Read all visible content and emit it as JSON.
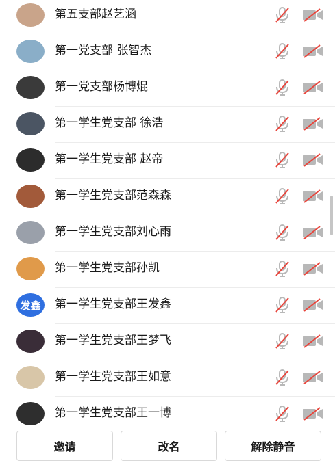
{
  "participants": [
    {
      "name": "第五支部赵艺涵",
      "avatar_color": "#c9a48a",
      "mic_muted": true,
      "camera_off": true
    },
    {
      "name": "第一党支部 张智杰",
      "avatar_color": "#8aaec8",
      "mic_muted": true,
      "camera_off": true
    },
    {
      "name": "第一党支部杨博焜",
      "avatar_color": "#3a3a3a",
      "mic_muted": true,
      "camera_off": true
    },
    {
      "name": "第一学生党支部 徐浩",
      "avatar_color": "#4b5563",
      "mic_muted": true,
      "camera_off": true
    },
    {
      "name": "第一学生党支部 赵帝",
      "avatar_color": "#2c2c2c",
      "mic_muted": true,
      "camera_off": true
    },
    {
      "name": "第一学生党支部范森森",
      "avatar_color": "#a25a3a",
      "mic_muted": true,
      "camera_off": true
    },
    {
      "name": "第一学生党支部刘心雨",
      "avatar_color": "#9aa0aa",
      "mic_muted": true,
      "camera_off": true
    },
    {
      "name": "第一学生党支部孙凯",
      "avatar_color": "#e09a4a",
      "mic_muted": true,
      "camera_off": true
    },
    {
      "name": "第一学生党支部王发鑫",
      "avatar_text": "发鑫",
      "avatar_color": "#2f6fe0",
      "mic_muted": true,
      "camera_off": true
    },
    {
      "name": "第一学生党支部王梦飞",
      "avatar_color": "#3a2d38",
      "mic_muted": true,
      "camera_off": true
    },
    {
      "name": "第一学生党支部王如意",
      "avatar_color": "#d8c6a8",
      "mic_muted": true,
      "camera_off": true
    },
    {
      "name": "第一学生党支部王一博",
      "avatar_color": "#2e2e2e",
      "mic_muted": true,
      "camera_off": true
    }
  ],
  "actions": {
    "invite_label": "邀请",
    "rename_label": "改名",
    "unmute_label": "解除静音"
  },
  "colors": {
    "muted_icon": "#b8b8b8",
    "mute_slash": "#e8453c"
  }
}
